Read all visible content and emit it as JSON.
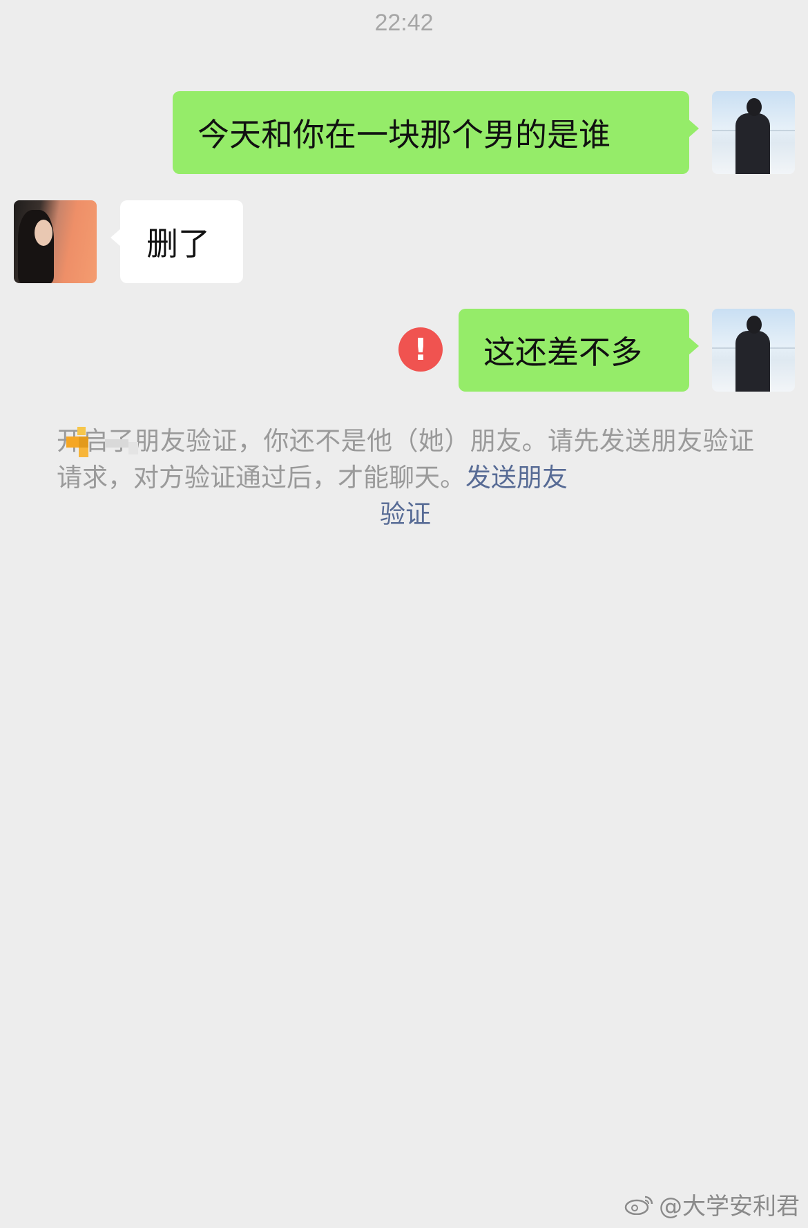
{
  "chat": {
    "timestamp": "22:42",
    "messages": [
      {
        "sender": "me",
        "text": "今天和你在一块那个男的是谁"
      },
      {
        "sender": "other",
        "text": "删了"
      },
      {
        "sender": "me",
        "text": "这还差不多",
        "failed": true
      }
    ],
    "system_notice": {
      "text": "开启了朋友验证，你还不是他（她）朋友。请先发送朋友验证请求，对方验证通过后，才能聊天。",
      "link_part1": "发送朋友",
      "link_part2": "验证"
    }
  },
  "watermark": {
    "text": "@大学安利君"
  },
  "colors": {
    "background": "#ededed",
    "my_bubble": "#95ec69",
    "other_bubble": "#ffffff",
    "error": "#f05350",
    "link": "#576b95"
  },
  "icons": {
    "error": "exclamation-circle-icon",
    "watermark": "weibo-icon"
  }
}
